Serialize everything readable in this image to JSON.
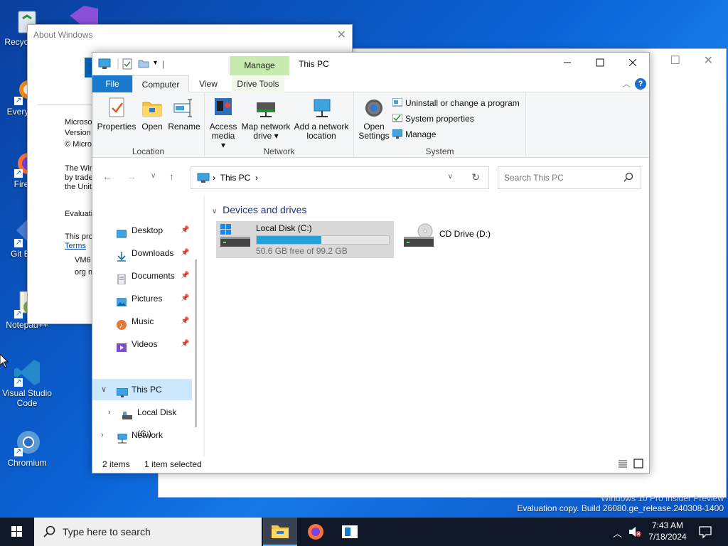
{
  "desktop": {
    "icons": [
      {
        "label": "Recycle Bin"
      },
      {
        "label": "Everything"
      },
      {
        "label": "Firefox"
      },
      {
        "label": "Git Bash"
      },
      {
        "label": "Notepad++"
      },
      {
        "label": "Visual Studio Code"
      },
      {
        "label": "Chromium"
      }
    ]
  },
  "about_window": {
    "title": "About Windows",
    "lines": [
      "Microsof",
      "Version",
      "© Micros",
      "The Win",
      "by trade",
      "the Unit",
      "Evaluati",
      "This pro",
      "Terms",
      "VM6",
      "org n"
    ]
  },
  "watermark": {
    "line1": "Windows 10 Pro Insider Preview",
    "line2": "Evaluation copy. Build 26080.ge_release.240308-1400"
  },
  "explorer": {
    "title": "This PC",
    "manage_tab": "Manage",
    "tabs": {
      "file": "File",
      "computer": "Computer",
      "view": "View",
      "drive_tools": "Drive Tools"
    },
    "help": "?",
    "ribbon": {
      "location_group": "Location",
      "network_group": "Network",
      "system_group": "System",
      "properties": "Properties",
      "open": "Open",
      "rename": "Rename",
      "access_media_1": "Access",
      "access_media_2": "media",
      "map_drive_1": "Map network",
      "map_drive_2": "drive",
      "add_location_1": "Add a network",
      "add_location_2": "location",
      "open_settings_1": "Open",
      "open_settings_2": "Settings",
      "uninstall": "Uninstall or change a program",
      "system_properties": "System properties",
      "manage": "Manage"
    },
    "address": {
      "path": "This PC",
      "search_placeholder": "Search This PC"
    },
    "nav": {
      "desktop": "Desktop",
      "downloads": "Downloads",
      "documents": "Documents",
      "pictures": "Pictures",
      "music": "Music",
      "videos": "Videos",
      "this_pc": "This PC",
      "local_disk": "Local Disk (C:)",
      "network": "Network"
    },
    "content": {
      "section": "Devices and drives",
      "drives": [
        {
          "name": "Local Disk (C:)",
          "free": "50.6 GB free of 99.2 GB",
          "used_fraction": 0.49
        },
        {
          "name": "CD Drive (D:)"
        }
      ]
    },
    "status": {
      "items": "2 items",
      "selected": "1 item selected"
    }
  },
  "taskbar": {
    "search_placeholder": "Type here to search",
    "time": "7:43 AM",
    "date": "7/18/2024"
  }
}
